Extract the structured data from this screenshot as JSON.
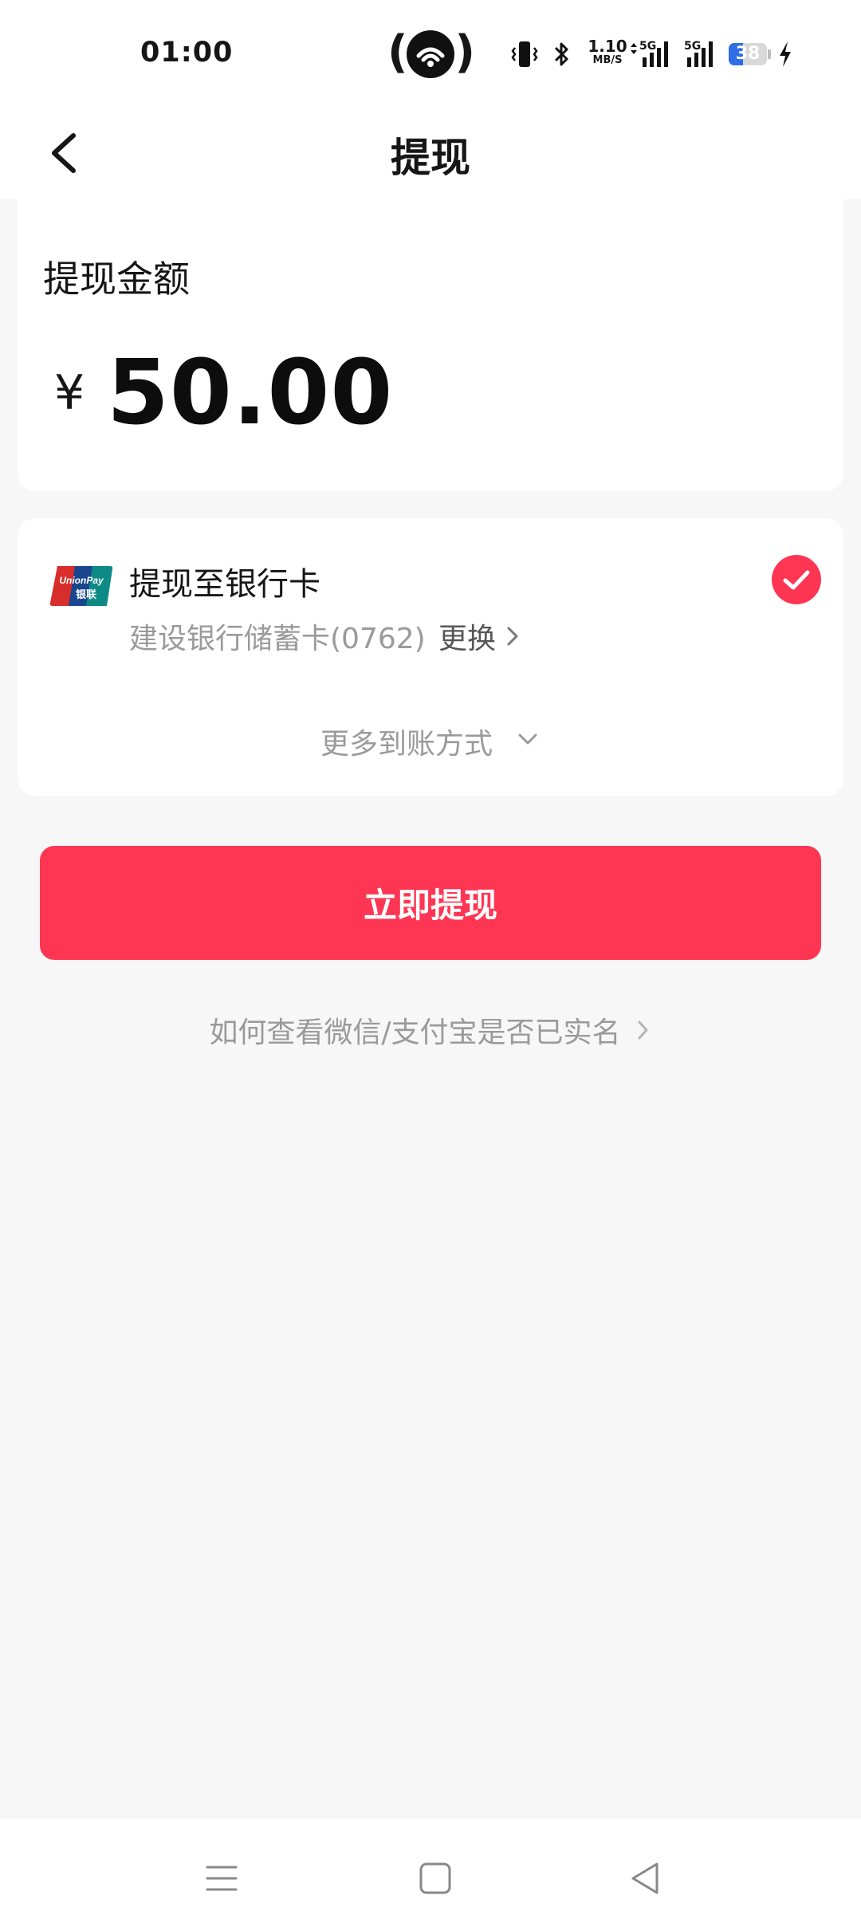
{
  "status_bar": {
    "time": "01:00",
    "net_speed_value": "1.10",
    "net_speed_unit": "MB/S",
    "signal_1_label": "5G",
    "signal_2_label": "5G",
    "battery_level": "38",
    "battery_fraction": 0.38,
    "accent_color": "#2f6ee6"
  },
  "header": {
    "title": "提现",
    "back_icon": "chevron-left-icon"
  },
  "amount_card": {
    "label": "提现金额",
    "currency_symbol": "¥",
    "amount": "50.00"
  },
  "payout_method": {
    "icon": "unionpay-logo",
    "title": "提现至银行卡",
    "card_info": "建设银行储蓄卡(0762)",
    "change_label": "更换",
    "selected": true,
    "selected_color": "#fe3653",
    "more_label": "更多到账方式"
  },
  "primary_button": {
    "label": "立即提现",
    "color": "#fe3653"
  },
  "help_link": {
    "label": "如何查看微信/支付宝是否已实名"
  },
  "system_nav": {
    "items": [
      "menu-icon",
      "home-square-icon",
      "back-triangle-icon"
    ]
  }
}
